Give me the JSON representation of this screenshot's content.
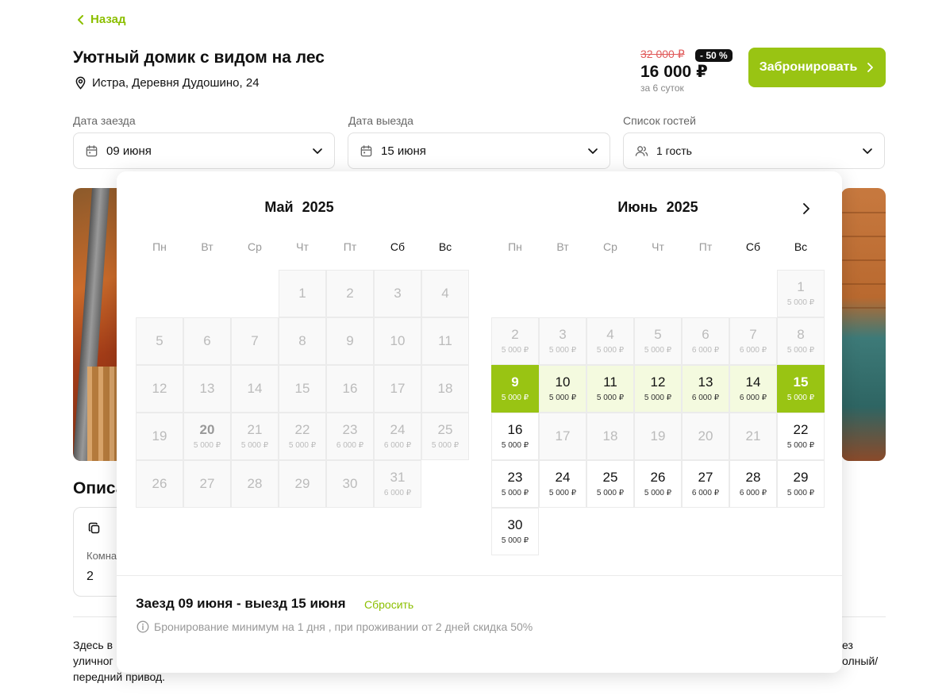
{
  "back_label": "Назад",
  "title": "Уютный домик с видом на лес",
  "address": "Истра, Деревня Дудошино, 24",
  "price": {
    "old": "32 000 ₽",
    "discount": "- 50 %",
    "new": "16 000 ₽",
    "note": "за 6 суток"
  },
  "book_label": "Забронировать",
  "fields": {
    "checkin_label": "Дата заезда",
    "checkin_value": "09 июня",
    "checkout_label": "Дата выезда",
    "checkout_value": "15 июня",
    "guests_label": "Список гостей",
    "guests_value": "1 гость"
  },
  "description": {
    "heading": "Описа",
    "room_label": "Комна",
    "room_value": "2",
    "text_left_1": "Здесь в",
    "text_left_2": "уличног",
    "text_left_3": "передний привод.",
    "text_right_1": "ез",
    "text_right_2": "олный/"
  },
  "calendar": {
    "weekdays": [
      "Пн",
      "Вт",
      "Ср",
      "Чт",
      "Пт",
      "Сб",
      "Вс"
    ],
    "months": [
      {
        "title": "Май 2025",
        "offset": 3,
        "days": [
          {
            "d": "1"
          },
          {
            "d": "2"
          },
          {
            "d": "3"
          },
          {
            "d": "4"
          },
          {
            "d": "5"
          },
          {
            "d": "6"
          },
          {
            "d": "7"
          },
          {
            "d": "8"
          },
          {
            "d": "9"
          },
          {
            "d": "10"
          },
          {
            "d": "11"
          },
          {
            "d": "12"
          },
          {
            "d": "13"
          },
          {
            "d": "14"
          },
          {
            "d": "15"
          },
          {
            "d": "16"
          },
          {
            "d": "17"
          },
          {
            "d": "18"
          },
          {
            "d": "19"
          },
          {
            "d": "20",
            "p": "5 000 ₽",
            "s": "today"
          },
          {
            "d": "21",
            "p": "5 000 ₽"
          },
          {
            "d": "22",
            "p": "5 000 ₽"
          },
          {
            "d": "23",
            "p": "6 000 ₽"
          },
          {
            "d": "24",
            "p": "6 000 ₽"
          },
          {
            "d": "25",
            "p": "5 000 ₽"
          },
          {
            "d": "26"
          },
          {
            "d": "27"
          },
          {
            "d": "28"
          },
          {
            "d": "29"
          },
          {
            "d": "30"
          },
          {
            "d": "31",
            "p": "6 000 ₽"
          }
        ]
      },
      {
        "title": "Июнь 2025",
        "offset": 6,
        "days": [
          {
            "d": "1",
            "p": "5 000 ₽"
          },
          {
            "d": "2",
            "p": "5 000 ₽"
          },
          {
            "d": "3",
            "p": "5 000 ₽"
          },
          {
            "d": "4",
            "p": "5 000 ₽"
          },
          {
            "d": "5",
            "p": "5 000 ₽"
          },
          {
            "d": "6",
            "p": "6 000 ₽"
          },
          {
            "d": "7",
            "p": "6 000 ₽"
          },
          {
            "d": "8",
            "p": "5 000 ₽"
          },
          {
            "d": "9",
            "p": "5 000 ₽",
            "s": "selected"
          },
          {
            "d": "10",
            "p": "5 000 ₽",
            "s": "inrange"
          },
          {
            "d": "11",
            "p": "5 000 ₽",
            "s": "inrange"
          },
          {
            "d": "12",
            "p": "5 000 ₽",
            "s": "inrange"
          },
          {
            "d": "13",
            "p": "6 000 ₽",
            "s": "inrange"
          },
          {
            "d": "14",
            "p": "6 000 ₽",
            "s": "inrange"
          },
          {
            "d": "15",
            "p": "5 000 ₽",
            "s": "selected"
          },
          {
            "d": "16",
            "p": "5 000 ₽",
            "s": "avail"
          },
          {
            "d": "17"
          },
          {
            "d": "18"
          },
          {
            "d": "19"
          },
          {
            "d": "20"
          },
          {
            "d": "21"
          },
          {
            "d": "22",
            "p": "5 000 ₽",
            "s": "avail"
          },
          {
            "d": "23",
            "p": "5 000 ₽",
            "s": "avail"
          },
          {
            "d": "24",
            "p": "5 000 ₽",
            "s": "avail"
          },
          {
            "d": "25",
            "p": "5 000 ₽",
            "s": "avail"
          },
          {
            "d": "26",
            "p": "5 000 ₽",
            "s": "avail"
          },
          {
            "d": "27",
            "p": "6 000 ₽",
            "s": "avail"
          },
          {
            "d": "28",
            "p": "6 000 ₽",
            "s": "avail"
          },
          {
            "d": "29",
            "p": "5 000 ₽",
            "s": "avail"
          },
          {
            "d": "30",
            "p": "5 000 ₽",
            "s": "avail"
          }
        ]
      }
    ],
    "summary": "Заезд 09 июня - выезд 15 июня",
    "reset_label": "Сбросить",
    "info": "Бронирование минимум на 1 дня , при проживании от 2 дней скидка 50%"
  },
  "colors": {
    "accent": "#99c413",
    "accent_text": "#8cbf00",
    "range": "#f4fadf",
    "old_price": "#e05a5a"
  }
}
